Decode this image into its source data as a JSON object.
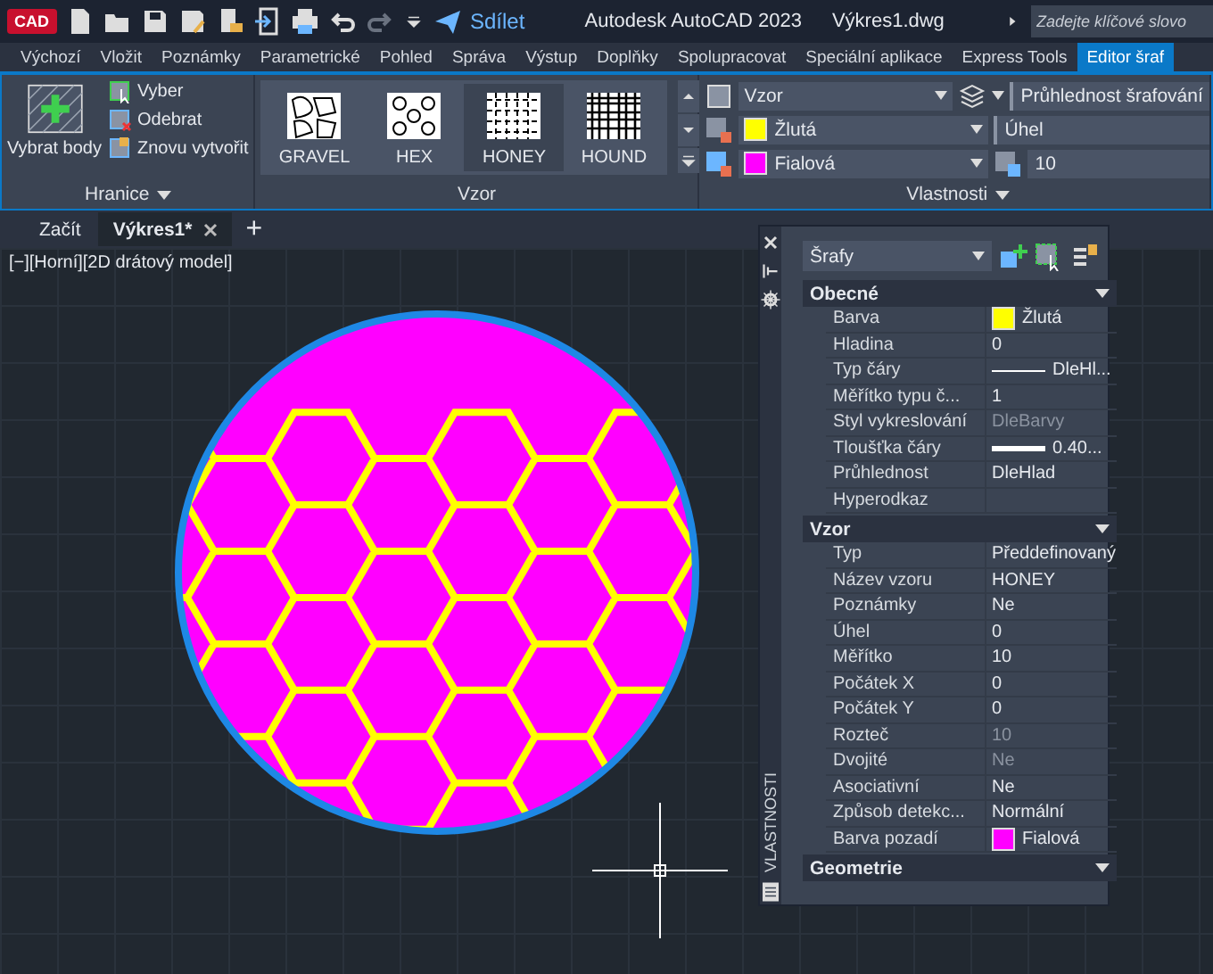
{
  "app_badge": "CAD",
  "title_bar": {
    "title": "Autodesk AutoCAD 2023",
    "file": "Výkres1.dwg",
    "share": "Sdílet",
    "search": {
      "placeholder": "Zadejte klíčové slovo"
    }
  },
  "ribbon_tabs": [
    {
      "label": "Výchozí",
      "selected": false
    },
    {
      "label": "Vložit",
      "selected": false
    },
    {
      "label": "Poznámky",
      "selected": false
    },
    {
      "label": "Parametrické",
      "selected": false
    },
    {
      "label": "Pohled",
      "selected": false
    },
    {
      "label": "Správa",
      "selected": false
    },
    {
      "label": "Výstup",
      "selected": false
    },
    {
      "label": "Doplňky",
      "selected": false
    },
    {
      "label": "Spolupracovat",
      "selected": false
    },
    {
      "label": "Speciální aplikace",
      "selected": false
    },
    {
      "label": "Express Tools",
      "selected": false
    },
    {
      "label": "Editor šraf",
      "selected": true
    }
  ],
  "boundaries_panel": {
    "title": "Hranice",
    "big_button": "Vybrat body",
    "buttons": [
      "Vyber",
      "Odebrat",
      "Znovu vytvořit"
    ]
  },
  "pattern_panel": {
    "title": "Vzor",
    "patterns": [
      {
        "label": "GRAVEL",
        "selected": false
      },
      {
        "label": "HEX",
        "selected": false
      },
      {
        "label": "HONEY",
        "selected": true
      },
      {
        "label": "HOUND",
        "selected": false
      }
    ]
  },
  "properties_panel": {
    "title": "Vlastnosti",
    "type": "Vzor",
    "transparency": "Průhlednost šrafování",
    "color": {
      "label": "Žlutá",
      "color": "#ffff00"
    },
    "angle": "Úhel",
    "background": {
      "label": "Fialová",
      "color": "#ff00ff"
    },
    "scale": "10"
  },
  "doc_tabs": [
    {
      "label": "Začít",
      "selected": false,
      "closable": false
    },
    {
      "label": "Výkres1*",
      "selected": true,
      "closable": true
    }
  ],
  "add_tab": "+",
  "viewport_label": "[−][Horní][2D drátový model]",
  "palette": {
    "title": "VLASTNOSTI",
    "selector": "Šrafy",
    "sections": [
      {
        "title": "Obecné",
        "rows": [
          {
            "label": "Barva",
            "value": "Žlutá",
            "kind": "swatch",
            "color": "#ffff00",
            "disabled": false
          },
          {
            "label": "Hladina",
            "value": "0",
            "kind": "text",
            "disabled": false
          },
          {
            "label": "Typ čáry",
            "value": "DleHl...",
            "kind": "line",
            "disabled": false
          },
          {
            "label": "Měřítko typu č...",
            "value": "1",
            "kind": "text",
            "disabled": false
          },
          {
            "label": "Styl vykreslování",
            "value": "DleBarvy",
            "kind": "text",
            "disabled": true
          },
          {
            "label": "Tloušťka čáry",
            "value": "0.40...",
            "kind": "thick",
            "disabled": false
          },
          {
            "label": "Průhlednost",
            "value": "DleHlad",
            "kind": "text",
            "disabled": false
          },
          {
            "label": "Hyperodkaz",
            "kind": "text"
          }
        ]
      },
      {
        "title": "Vzor",
        "rows": [
          {
            "label": "Typ",
            "value": "Předdefinovaný",
            "kind": "text",
            "disabled": false
          },
          {
            "label": "Název vzoru",
            "value": "HONEY",
            "kind": "text",
            "disabled": false
          },
          {
            "label": "Poznámky",
            "value": "Ne",
            "kind": "text",
            "disabled": false
          },
          {
            "label": "Úhel",
            "value": "0",
            "kind": "text",
            "disabled": false
          },
          {
            "label": "Měřítko",
            "value": "10",
            "kind": "text",
            "disabled": false
          },
          {
            "label": "Počátek X",
            "value": "0",
            "kind": "text",
            "disabled": false
          },
          {
            "label": "Počátek Y",
            "value": "0",
            "kind": "text",
            "disabled": false
          },
          {
            "label": "Rozteč",
            "value": "10",
            "kind": "text",
            "disabled": true
          },
          {
            "label": "Dvojité",
            "value": "Ne",
            "kind": "text",
            "disabled": true
          },
          {
            "label": "Asociativní",
            "value": "Ne",
            "kind": "text",
            "disabled": false
          },
          {
            "label": "Způsob detekc...",
            "value": "Normální",
            "kind": "text",
            "disabled": false
          },
          {
            "label": "Barva pozadí",
            "value": "Fialová",
            "kind": "swatch",
            "color": "#ff00ff",
            "disabled": false
          }
        ]
      },
      {
        "title": "Geometrie"
      }
    ]
  }
}
